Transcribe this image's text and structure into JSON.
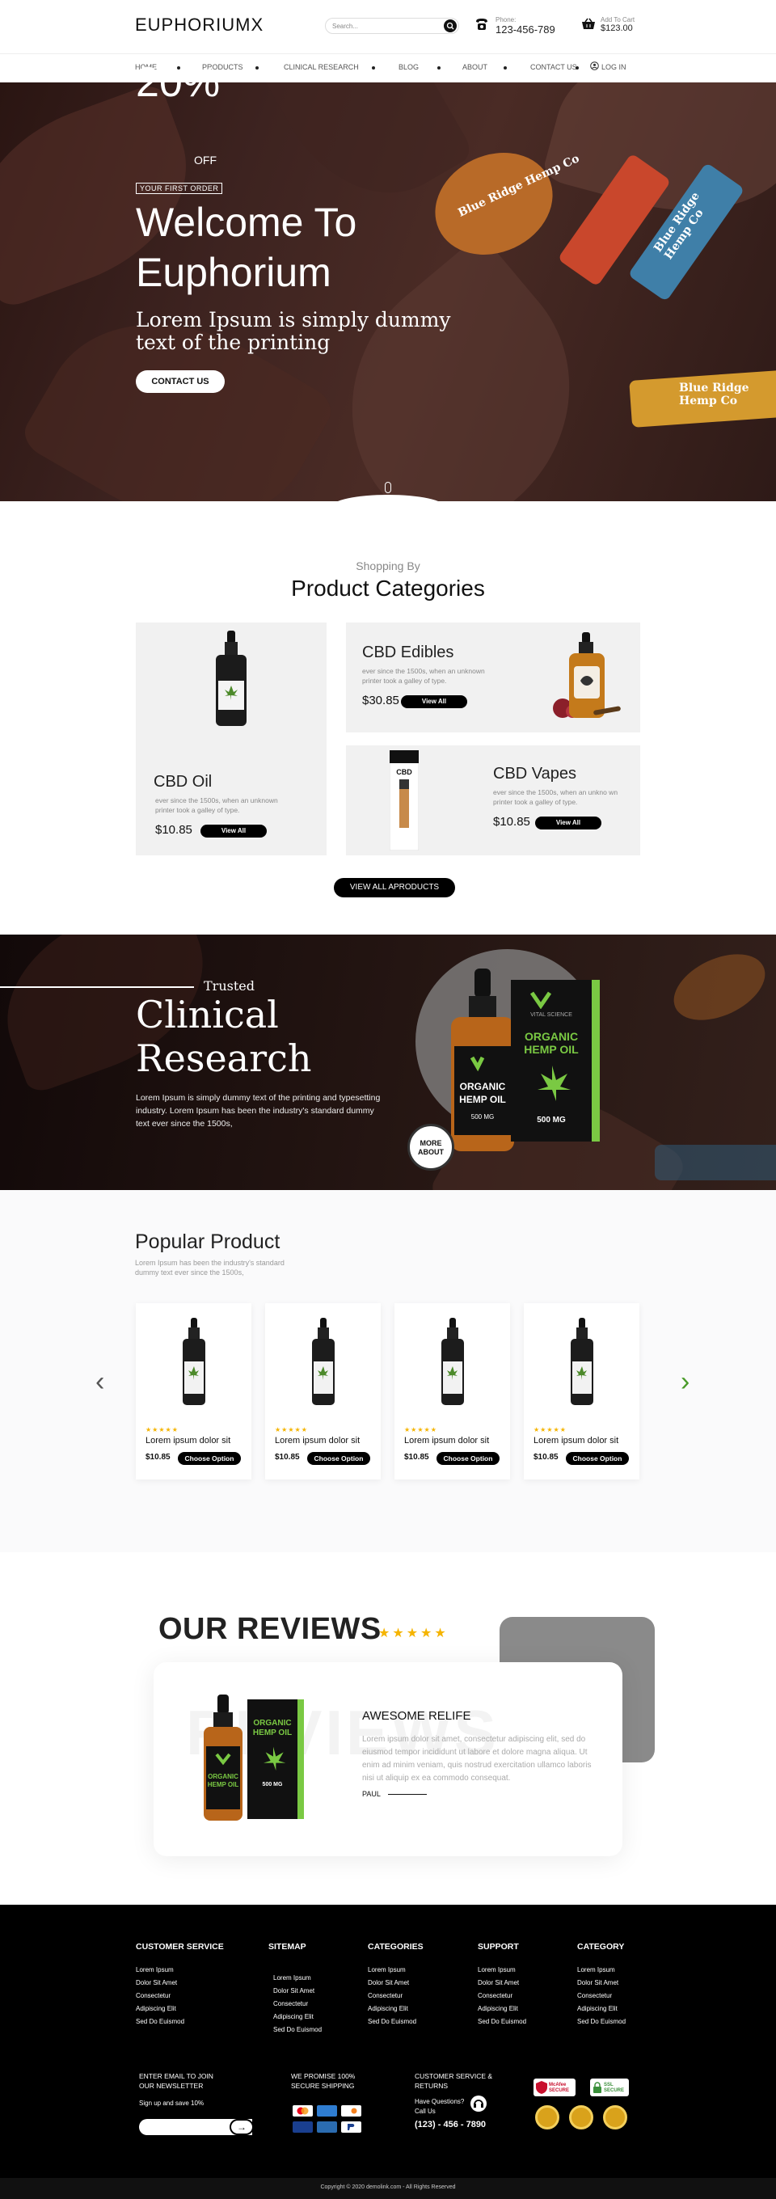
{
  "header": {
    "logo": "EUPHORIUMX",
    "search_placeholder": "Search...",
    "phone_label": "Phone:",
    "phone_number": "123-456-789",
    "cart_label": "Add To Cart",
    "cart_amount": "$123.00"
  },
  "nav": {
    "items": [
      "Home",
      "Products",
      "Clinical Research",
      "Blog",
      "About",
      "Contact Us"
    ],
    "login": "Log In"
  },
  "hero": {
    "percent": "20%",
    "off": "OFF",
    "first_order": "YOUR FIRST ORDER",
    "title_line1": "Welcome To",
    "title_line2": "Euphorium",
    "subtitle": "Lorem Ipsum is simply dummy text of the printing",
    "button": "CONTACT US",
    "scroll": "SCROLL DOWN",
    "product_labels": [
      "Blue Ridge Hemp Co",
      "Blue Ridge Hemp Co",
      "Blue Ridge Hemp Co"
    ]
  },
  "categories": {
    "kicker": "Shopping By",
    "title": "Product Categories",
    "items": [
      {
        "name": "CBD Oil",
        "desc": "ever since the 1500s, when an unknown printer took a galley of type.",
        "price": "$10.85",
        "button": "View All"
      },
      {
        "name": "CBD Edibles",
        "desc": "ever since the 1500s, when an unknown printer took a galley of type.",
        "price": "$30.85",
        "button": "View All"
      },
      {
        "name": "CBD Vapes",
        "desc": "ever since the 1500s, when an unkno wn printer took a galley of type.",
        "price": "$10.85",
        "button": "View All"
      }
    ],
    "view_all": "VIEW ALL APRODUCTS"
  },
  "research": {
    "kicker": "Trusted",
    "title_line1": "Clinical",
    "title_line2": "Research",
    "body": "Lorem Ipsum is simply dummy text of the printing and typesetting industry. Lorem Ipsum has been the industry's standard dummy text ever since the 1500s,",
    "more_line1": "MORE",
    "more_line2": "ABOUT",
    "box_brand": "VITAL SCIENCE",
    "box_line1": "ORGANIC",
    "box_line2": "HEMP OIL",
    "box_mg": "500 MG"
  },
  "popular": {
    "title": "Popular Product",
    "desc": "Lorem Ipsum has been the industry's standard dummy text ever since the 1500s,",
    "products": [
      {
        "stars": "★★★★★",
        "name": "Lorem ipsum dolor sit",
        "price": "$10.85",
        "button": "Choose Option"
      },
      {
        "stars": "★★★★★",
        "name": "Lorem ipsum dolor sit",
        "price": "$10.85",
        "button": "Choose Option"
      },
      {
        "stars": "★★★★★",
        "name": "Lorem ipsum dolor sit",
        "price": "$10.85",
        "button": "Choose Option"
      },
      {
        "stars": "★★★★★",
        "name": "Lorem ipsum dolor sit",
        "price": "$10.85",
        "button": "Choose Option"
      }
    ],
    "prev": "‹",
    "next": "›"
  },
  "reviews": {
    "title": "OUR REVIEWS",
    "stars": "★★★★★",
    "watermark": "REVIEWS",
    "heading": "AWESOME RELIFE",
    "body": "Lorem ipsum dolor sit amet, consectetur adipiscing elit, sed do eiusmod tempor incididunt ut labore et dolore magna aliqua. Ut enim ad minim veniam, quis nostrud exercitation ullamco laboris nisi ut aliquip ex ea commodo consequat.",
    "author": "PAUL",
    "box_line1": "ORGANIC",
    "box_line2": "HEMP OIL",
    "box_mg": "500 MG"
  },
  "footer": {
    "columns": [
      {
        "title": "CUSTOMER SERVICE",
        "links": [
          "Lorem Ipsum",
          "Dolor Sit Amet",
          "Consectetur",
          "Adipiscing Elit",
          "Sed Do Euismod"
        ]
      },
      {
        "title": "SITEMAP",
        "links": [
          "Lorem Ipsum",
          "Dolor Sit Amet",
          "Consectetur",
          "Adipiscing Elit",
          "Sed Do Euismod"
        ]
      },
      {
        "title": "CATEGORIES",
        "links": [
          "Lorem Ipsum",
          "Dolor Sit Amet",
          "Consectetur",
          "Adipiscing Elit",
          "Sed Do Euismod"
        ]
      },
      {
        "title": "SUPPORT",
        "links": [
          "Lorem Ipsum",
          "Dolor Sit Amet",
          "Consectetur",
          "Adipiscing Elit",
          "Sed Do Euismod"
        ]
      },
      {
        "title": "CATEGORY",
        "links": [
          "Lorem Ipsum",
          "Dolor Sit Amet",
          "Consectetur",
          "Adipiscing Elit",
          "Sed Do Euismod"
        ]
      }
    ],
    "newsletter_title": "ENTER EMAIL TO JOIN OUR NEWSLETTER",
    "newsletter_sub": "Sign up and save 10%",
    "send": "→",
    "promise": "WE PROMISE 100% SECURE SHIPPING",
    "service_title": "CUSTOMER SERVICE & RETURNS",
    "service_q": "Have Questions? Call Us",
    "service_phone": "(123) - 456 - 7890",
    "badges": [
      "McAfee SECURE",
      "SSL SECURE"
    ],
    "copyright": "Copyright © 2020 demolink.com - All Rights Reserved",
    "colors": {
      "paypal": "#ffffff",
      "visa": "#1a3f8f",
      "amex": "#2f7dd1",
      "mastercard": "#eb5a1d"
    }
  }
}
